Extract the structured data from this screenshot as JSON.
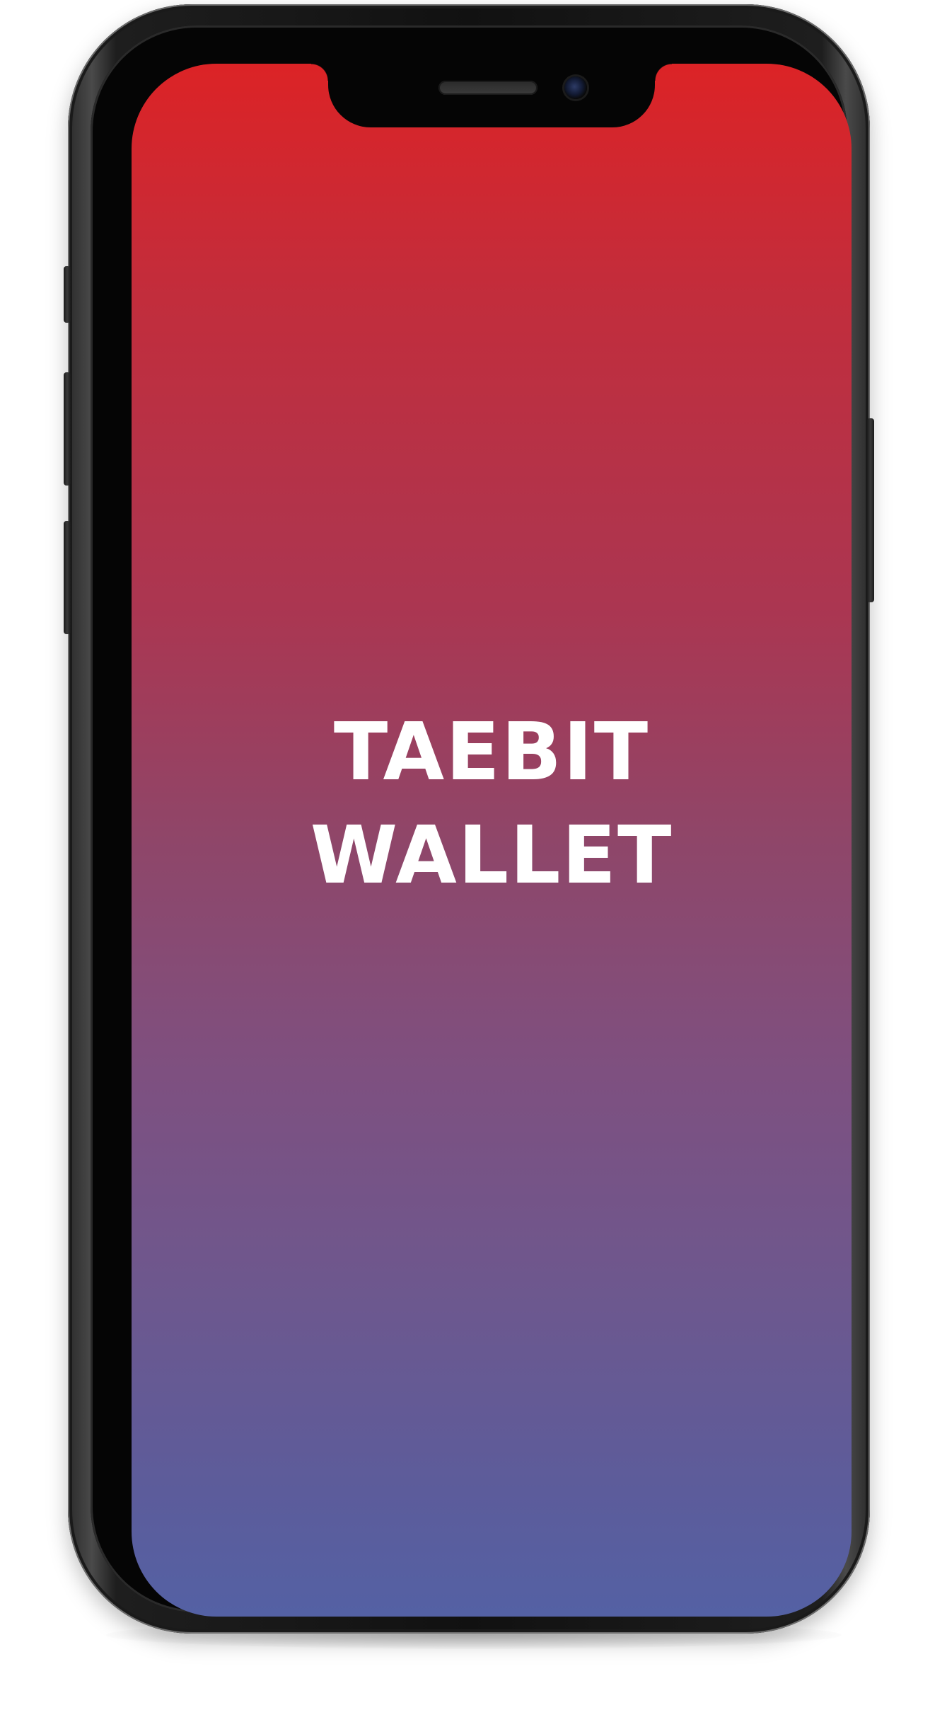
{
  "app": {
    "title_line_1": "TAEBIT",
    "title_line_2": "WALLET"
  },
  "theme": {
    "gradient_top": "#dc2326",
    "gradient_bottom": "#5461a4",
    "text_color": "#ffffff",
    "device_frame": "#111111"
  }
}
